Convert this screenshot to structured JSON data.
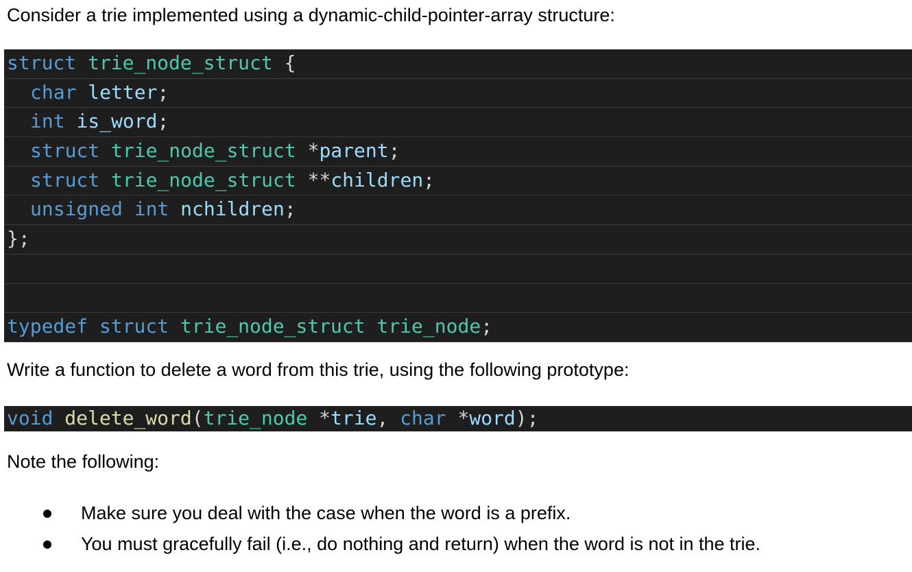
{
  "intro": "Consider a trie implemented using a dynamic-child-pointer-array structure:",
  "struct_code": {
    "line1": {
      "kw": "struct",
      "type": "trie_node_struct",
      "brace": "{"
    },
    "line2": {
      "kw": "char",
      "name": "letter",
      "semi": ";"
    },
    "line3": {
      "kw": "int",
      "name": "is_word",
      "semi": ";"
    },
    "line4": {
      "kw": "struct",
      "type": "trie_node_struct",
      "ptr": "*",
      "name": "parent",
      "semi": ";"
    },
    "line5": {
      "kw": "struct",
      "type": "trie_node_struct",
      "ptr": "**",
      "name": "children",
      "semi": ";"
    },
    "line6": {
      "kw1": "unsigned",
      "kw2": "int",
      "name": "nchildren",
      "semi": ";"
    },
    "line7": {
      "close": "};"
    },
    "line10": {
      "kw1": "typedef",
      "kw2": "struct",
      "type1": "trie_node_struct",
      "type2": "trie_node",
      "semi": ";"
    }
  },
  "instruction": "Write a function to delete a word from this trie, using the following prototype:",
  "prototype": {
    "ret": "void",
    "fname": "delete_word",
    "open": "(",
    "p1type": "trie_node",
    "p1ptr": "*",
    "p1name": "trie",
    "comma": ",",
    "p2type": "char",
    "p2ptr": "*",
    "p2name": "word",
    "close": ");"
  },
  "note_heading": "Note the following:",
  "notes": [
    "Make sure you deal with the case when the word is a prefix.",
    "You must gracefully fail (i.e., do nothing and return) when the word is not in the trie."
  ]
}
